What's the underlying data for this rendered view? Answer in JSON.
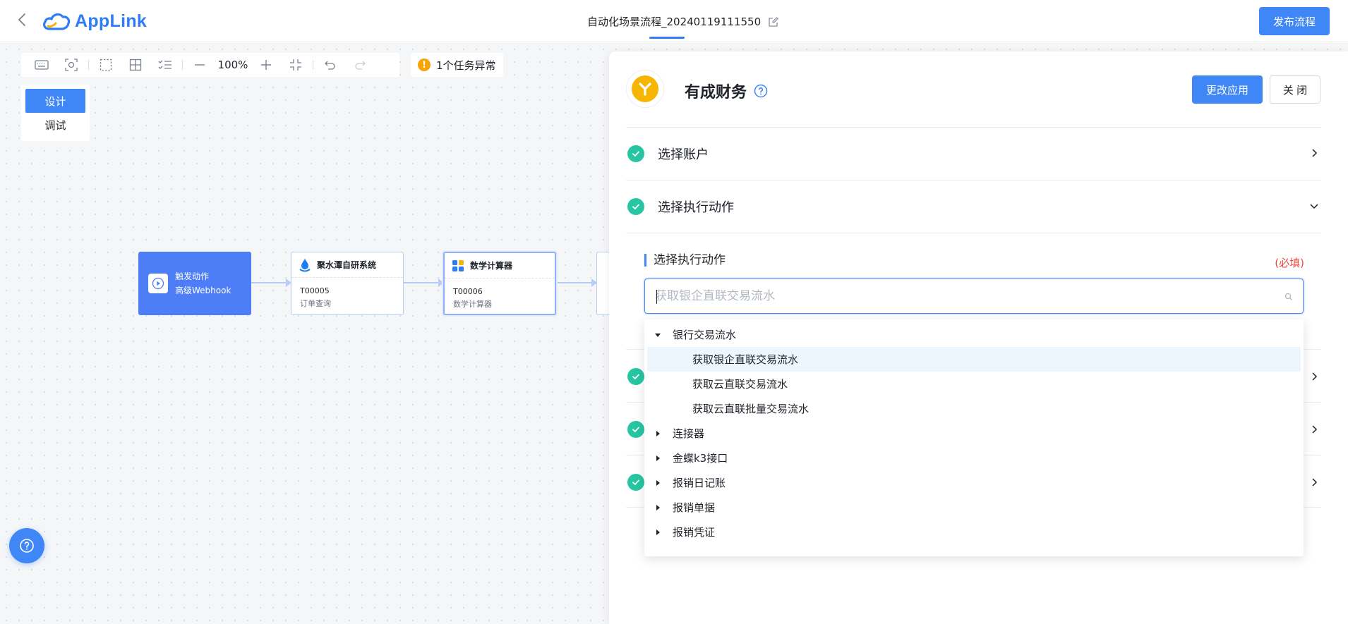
{
  "header": {
    "logo_text": "AppLink",
    "flow_title": "自动化场景流程_20240119111550",
    "publish_label": "发布流程"
  },
  "toolbar": {
    "zoom": "100%",
    "alert_text": "1个任务异常"
  },
  "mode": {
    "design": "设计",
    "debug": "调试"
  },
  "nodes": {
    "trigger": {
      "title": "触发动作",
      "subtitle": "高级Webhook"
    },
    "node1": {
      "title": "聚水潭自研系统",
      "code": "T00005",
      "desc": "订单查询"
    },
    "node2": {
      "title": "数学计算器",
      "code": "T00006",
      "desc": "数学计算器"
    }
  },
  "panel": {
    "app_name": "有成财务",
    "change_app_label": "更改应用",
    "close_label": "关 闭",
    "steps": [
      {
        "label": "选择账户"
      },
      {
        "label": "选择执行动作"
      }
    ],
    "field_label": "选择执行动作",
    "required_text": "(必填)",
    "search_placeholder": "获取银企直联交易流水"
  },
  "tree": {
    "groups": [
      {
        "label": "银行交易流水",
        "expanded": true
      },
      {
        "label": "连接器"
      },
      {
        "label": "金蝶k3接口"
      },
      {
        "label": "报销日记账"
      },
      {
        "label": "报销单据"
      },
      {
        "label": "报销凭证"
      }
    ],
    "leaves": [
      {
        "label": "获取银企直联交易流水",
        "active": true
      },
      {
        "label": "获取云直联交易流水"
      },
      {
        "label": "获取云直联批量交易流水"
      }
    ]
  },
  "colors": {
    "primary": "#3f86f7",
    "success": "#26c6a2",
    "warning": "#f7a400",
    "danger": "#f0483e",
    "trigger": "#4e7ef7"
  }
}
